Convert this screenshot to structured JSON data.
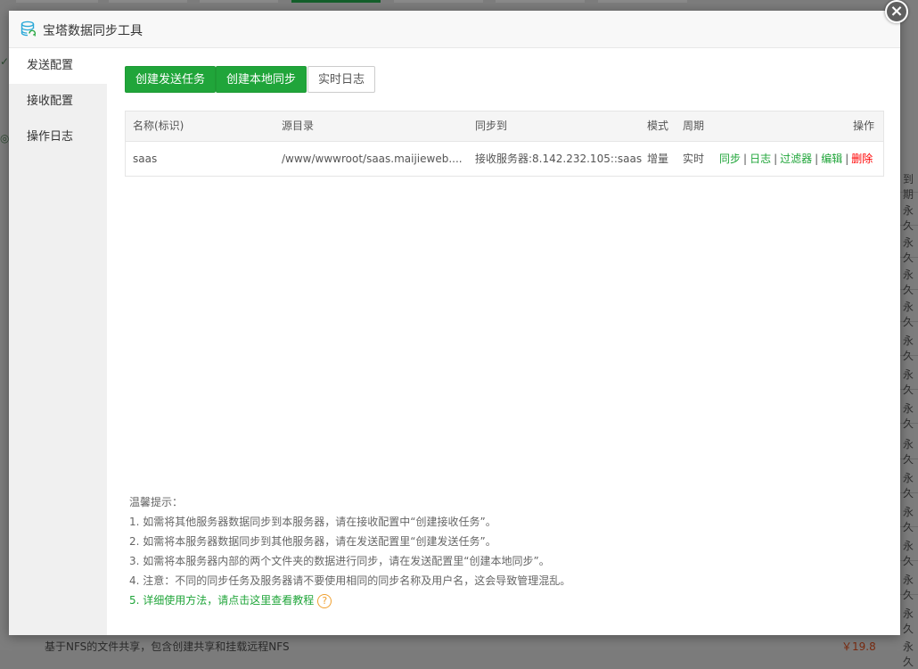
{
  "background": {
    "row_cells": [
      "到期",
      "永久",
      "永久",
      "永久",
      "永久",
      "永久",
      "永久",
      "永久",
      "永久",
      "永久",
      "永久",
      "永久",
      "永久",
      "永久",
      "永久"
    ],
    "footer_text": "基于NFS的文件共享，包含创建共享和挂载远程NFS",
    "footer_price": "￥19.8"
  },
  "modal": {
    "title": "宝塔数据同步工具",
    "close_label": "×",
    "icon": "database-sync-icon"
  },
  "sidebar": {
    "items": [
      {
        "label": "发送配置",
        "active": true
      },
      {
        "label": "接收配置",
        "active": false
      },
      {
        "label": "操作日志",
        "active": false
      }
    ]
  },
  "toolbar": {
    "create_send_label": "创建发送任务",
    "create_local_label": "创建本地同步",
    "realtime_log_label": "实时日志"
  },
  "table": {
    "headers": {
      "name": "名称(标识)",
      "source": "源目录",
      "target": "同步到",
      "mode": "模式",
      "period": "周期",
      "action": "操作"
    },
    "rows": [
      {
        "name": "saas",
        "source": "/www/wwwroot/saas.maijieweb....",
        "target": "接收服务器:8.142.232.105::saas",
        "mode": "增量",
        "period": "实时",
        "actions": {
          "sync": "同步",
          "log": "日志",
          "filter": "过滤器",
          "edit": "编辑",
          "delete": "删除",
          "separator": "|"
        }
      }
    ]
  },
  "tips": {
    "title": "温馨提示：",
    "lines": [
      "1. 如需将其他服务器数据同步到本服务器，请在接收配置中“创建接收任务”。",
      "2. 如需将本服务器数据同步到其他服务器，请在发送配置里“创建发送任务”。",
      "3. 如需将本服务器内部的两个文件夹的数据进行同步，请在发送配置里“创建本地同步”。",
      "4. 注意：不同的同步任务及服务器请不要使用相同的同步名称及用户名，这会导致管理混乱。"
    ],
    "link": "5. 详细使用方法，请点击这里查看教程",
    "help_glyph": "?"
  },
  "colors": {
    "accent_green": "#20a53a",
    "delete_red": "#ff0000",
    "help_orange": "#f0a030"
  }
}
